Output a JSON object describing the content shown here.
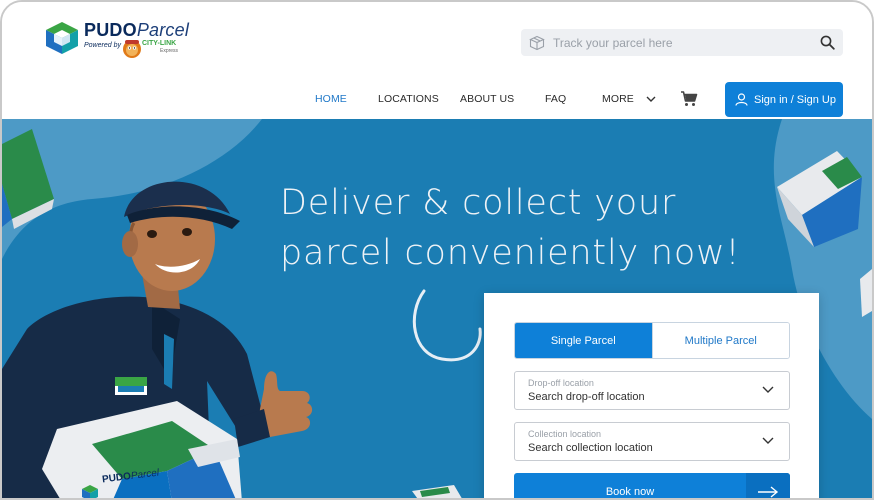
{
  "brand": {
    "name_bold": "PUDO",
    "name_light": "Parcel",
    "powered_by": "Powered by",
    "partner": "CITY-LINK",
    "partner_sub": "Express",
    "colors": {
      "navy": "#0a2a5c",
      "green": "#3aa545",
      "blue": "#1f78c8"
    }
  },
  "header": {
    "track_placeholder": "Track your parcel here",
    "track_icon": "parcel-box-icon",
    "search_icon": "search-icon",
    "nav": [
      {
        "label": "HOME",
        "active": true
      },
      {
        "label": "LOCATIONS",
        "active": false
      },
      {
        "label": "ABOUT US",
        "active": false
      },
      {
        "label": "FAQ",
        "active": false
      },
      {
        "label": "MORE",
        "active": false
      }
    ],
    "cart_icon": "cart-icon",
    "signin_label": "Sign in / Sign Up",
    "signin_icon": "user-icon"
  },
  "hero": {
    "title_line1": "Deliver & collect your",
    "title_line2": "parcel conveniently now!",
    "background": "#1b7db3",
    "box_label": "PUDOParcel",
    "box_label_bold": "PUDO",
    "box_label_light": "Parcel"
  },
  "booking": {
    "tabs": [
      {
        "label": "Single Parcel",
        "active": true
      },
      {
        "label": "Multiple Parcel",
        "active": false
      }
    ],
    "dropoff_label": "Drop-off location",
    "dropoff_value": "Search drop-off location",
    "collection_label": "Collection location",
    "collection_value": "Search collection location",
    "book_label": "Book now",
    "accent": "#0e80d8"
  }
}
